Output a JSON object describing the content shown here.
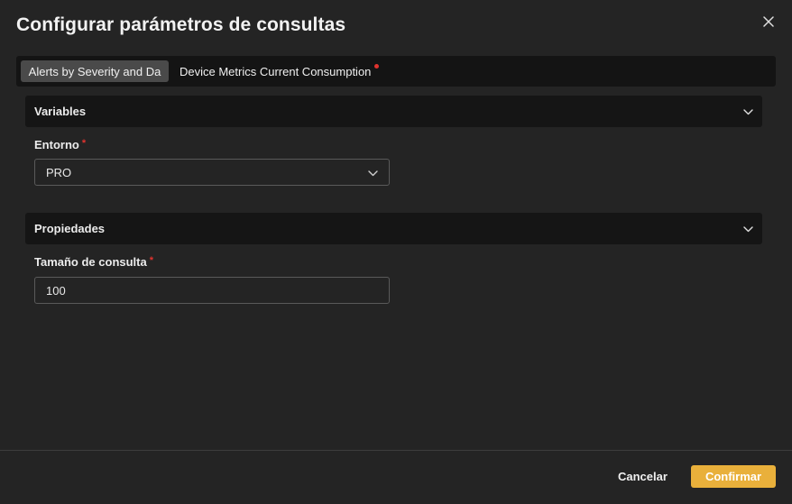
{
  "dialog": {
    "title": "Configurar parámetros de consultas",
    "close_icon": "close-icon"
  },
  "tabs": [
    {
      "label": "Alerts by Severity and Da",
      "active": true,
      "has_error": false
    },
    {
      "label": "Device Metrics Current Consumption",
      "active": false,
      "has_error": true
    }
  ],
  "sections": {
    "variables": {
      "title": "Variables",
      "icon": "chevron-down-icon",
      "fields": {
        "entorno": {
          "label": "Entorno",
          "required_mark": "*",
          "value": "PRO",
          "icon": "chevron-down-icon"
        }
      }
    },
    "propiedades": {
      "title": "Propiedades",
      "icon": "chevron-down-icon",
      "fields": {
        "tamano": {
          "label": "Tamaño de consulta",
          "required_mark": "*",
          "value": "100"
        }
      }
    }
  },
  "footer": {
    "cancel_label": "Cancelar",
    "confirm_label": "Confirmar"
  },
  "colors": {
    "background": "#242424",
    "header_bg": "#151515",
    "accent": "#e9b03b",
    "required": "#e0332e"
  }
}
